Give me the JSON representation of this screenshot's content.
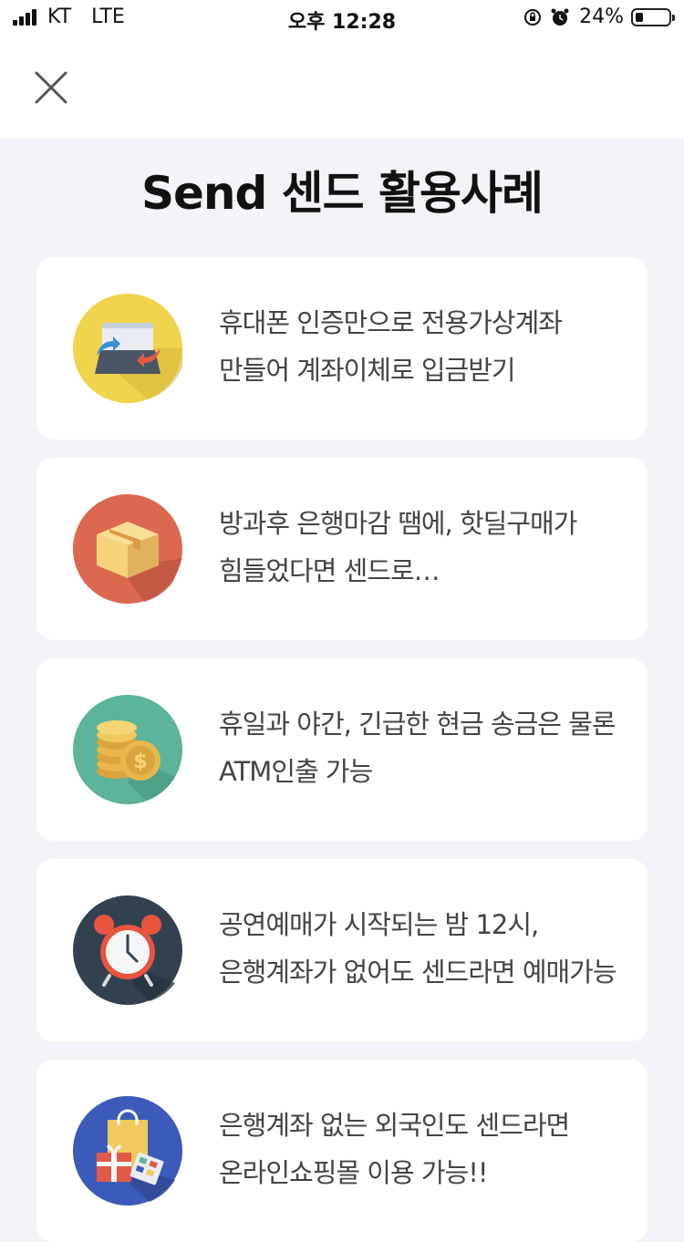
{
  "status_bar": {
    "carrier": "KT",
    "network": "LTE",
    "time": "오후 12:28",
    "battery": "24%",
    "battery_level": 0.24
  },
  "header": {
    "close_icon": "close-icon",
    "title": "Send 센드 활용사례"
  },
  "cases": [
    {
      "icon": "bank-transfer-icon",
      "text": "휴대폰 인증만으로 전용가상계좌 만들어 계좌이체로 입금받기"
    },
    {
      "icon": "package-box-icon",
      "text": "방과후 은행마감 땜에, 핫딜구매가 힘들었다면 센드로…"
    },
    {
      "icon": "coins-icon",
      "text": "휴일과 야간, 긴급한 현금 송금은 물론 ATM인출 가능"
    },
    {
      "icon": "alarm-clock-icon",
      "text": "공연예매가 시작되는 밤 12시, 은행계좌가 없어도 센드라면 예매가능"
    },
    {
      "icon": "shopping-bag-icon",
      "text": "은행계좌 없는 외국인도 센드라면 온라인쇼핑몰 이용 가능!!"
    }
  ],
  "colors": {
    "background": "#f3f4f8",
    "card": "#ffffff",
    "icon_yellow": "#f0d44c",
    "icon_red": "#dc6850",
    "icon_teal": "#5cb49b",
    "icon_navy": "#324150",
    "icon_blue": "#3c5ab9"
  }
}
